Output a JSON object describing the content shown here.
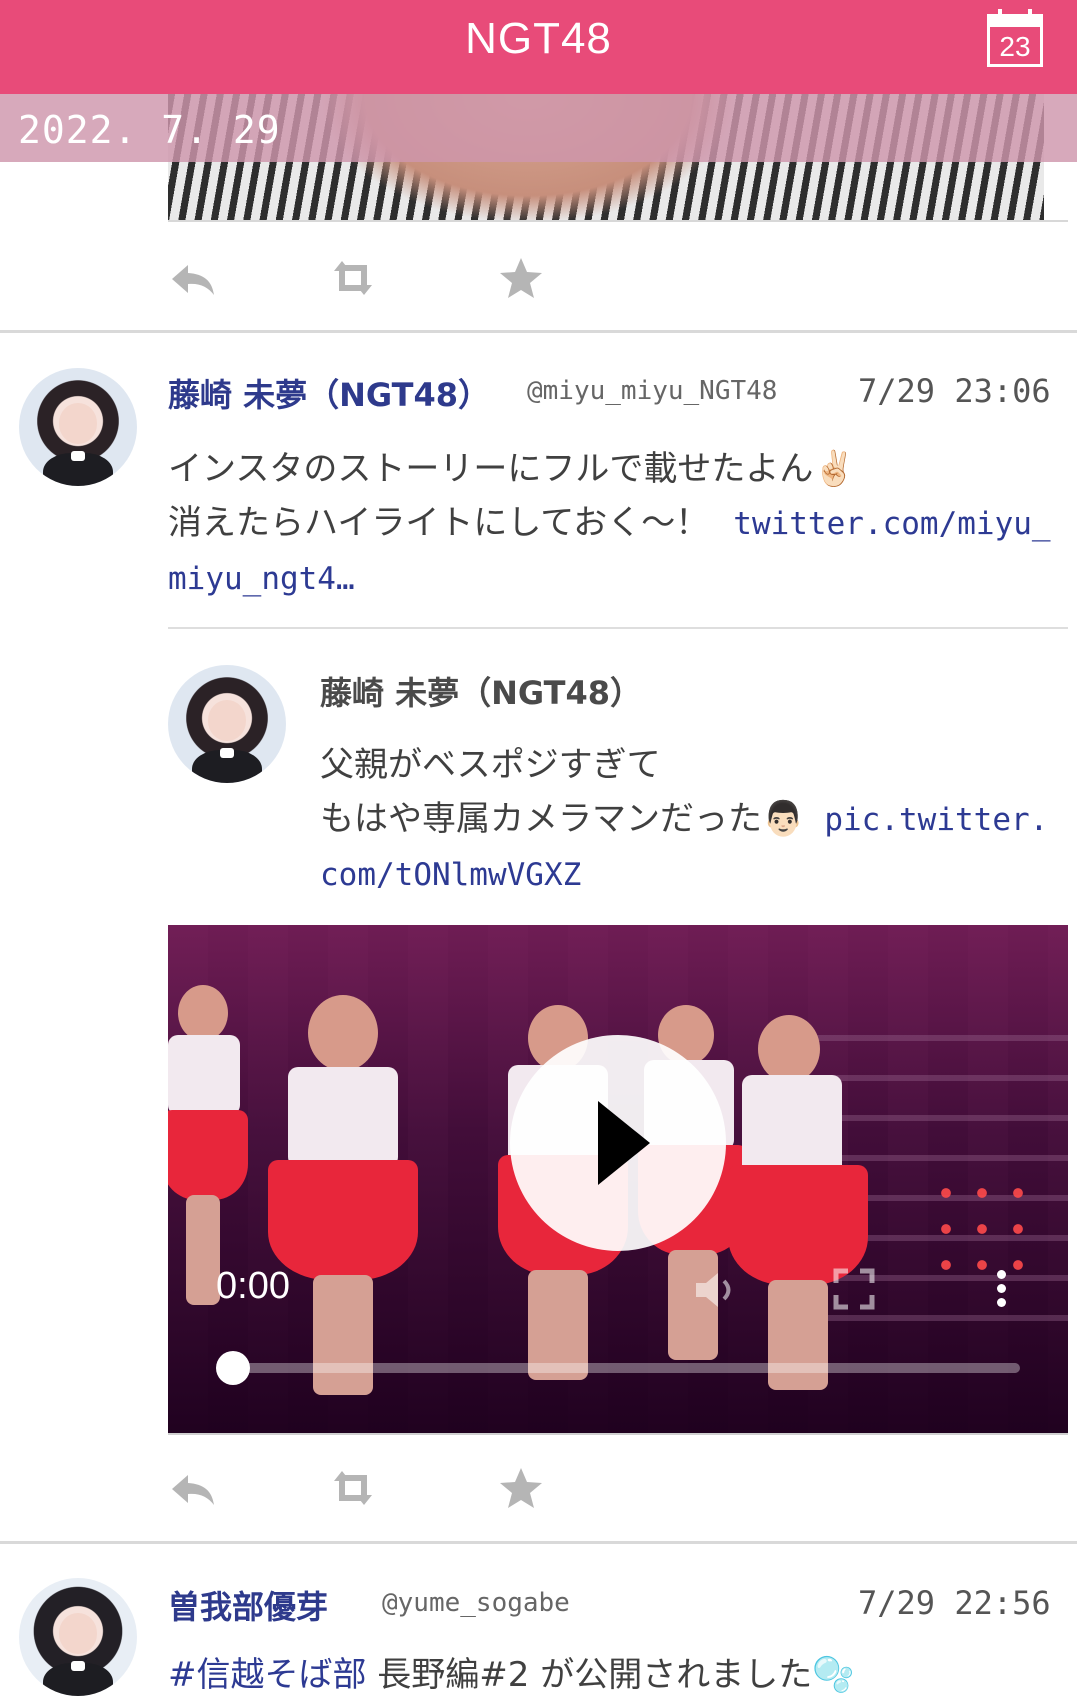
{
  "header": {
    "title": "NGT48",
    "calendar_day": "23"
  },
  "date_banner": {
    "text": "2022. 7. 29"
  },
  "tweets": [
    {
      "name": "藤崎 未夢（NGT48）",
      "handle": "@miyu_miyu_NGT48",
      "time": "7/29 23:06",
      "lines": [
        "インスタのストーリーにフルで載せたよん✌🏻",
        "消えたらハイライトにしておく〜！"
      ],
      "link_part1": "twitter.com/miyu_",
      "link_part2": "miyu_ngt4…",
      "quoted": {
        "name": "藤崎 未夢（NGT48）",
        "line1": "父親がベスポジすぎて",
        "line2": "もはや専属カメラマンだった👨🏻",
        "link_part1": "pic.twitter.",
        "link_part2": "com/tONlmwVGXZ"
      },
      "video": {
        "time": "0:00",
        "progress": 0
      }
    },
    {
      "name": "曽我部優芽",
      "handle": "@yume_sogabe",
      "time": "7/29 22:56",
      "hashtag": "#信越そば部",
      "text_rest": " 長野編#2 が公開されました🫧"
    }
  ],
  "icons": {
    "reply": "reply-icon",
    "retweet": "retweet-icon",
    "like": "star-icon",
    "calendar": "calendar-icon"
  },
  "colors": {
    "header": "#e84b79",
    "link": "#2d3a93",
    "icon_gray": "#b5b5b5"
  }
}
